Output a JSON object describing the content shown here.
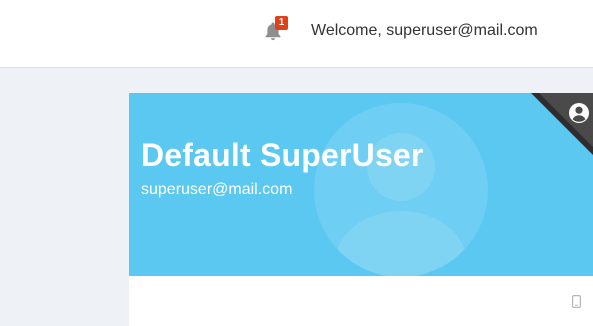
{
  "header": {
    "notifications": {
      "icon": "bell-icon",
      "count": "1"
    },
    "welcome_text": "Welcome, superuser@mail.com"
  },
  "profile_card": {
    "name": "Default SuperUser",
    "email": "superuser@mail.com",
    "header_color": "#5bc8f2",
    "corner_icon": "user-circle-icon",
    "background_icon": "user-avatar-icon",
    "detail_icon": "mobile-phone-icon"
  },
  "colors": {
    "badge": "#e2401c",
    "page_background": "#eef1f6"
  }
}
